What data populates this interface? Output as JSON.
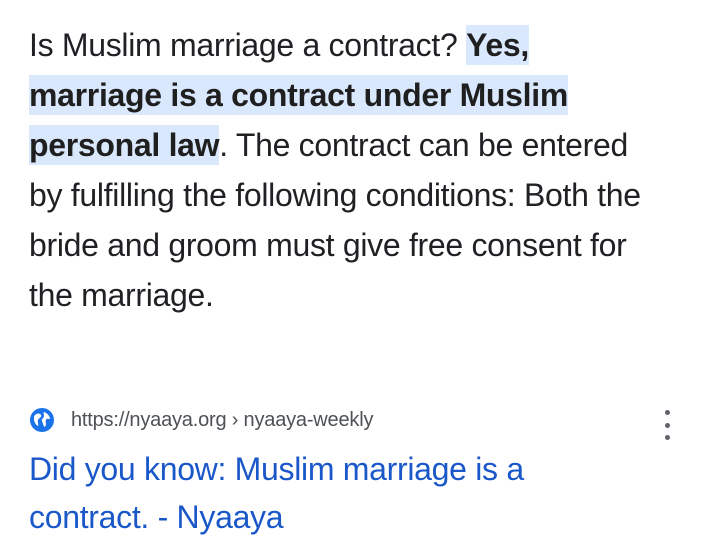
{
  "snippet": {
    "lead": "Is Muslim marriage a contract? ",
    "highlight": "Yes, marriage is a contract under Muslim personal law",
    "rest": ". The contract can be entered by fulfilling the following conditions: Both the bride and groom must give free consent for the marriage."
  },
  "source": {
    "url": "https://nyaaya.org › nyaaya-weekly",
    "icon": "globe-icon"
  },
  "result": {
    "title": "Did you know: Muslim marriage is a contract. - Nyaaya"
  },
  "menu": {
    "icon": "more-vert-icon"
  },
  "colors": {
    "highlight_bg": "#d9e8fc",
    "link": "#1a57c9",
    "globe": "#1a73e8",
    "text": "#202124"
  }
}
